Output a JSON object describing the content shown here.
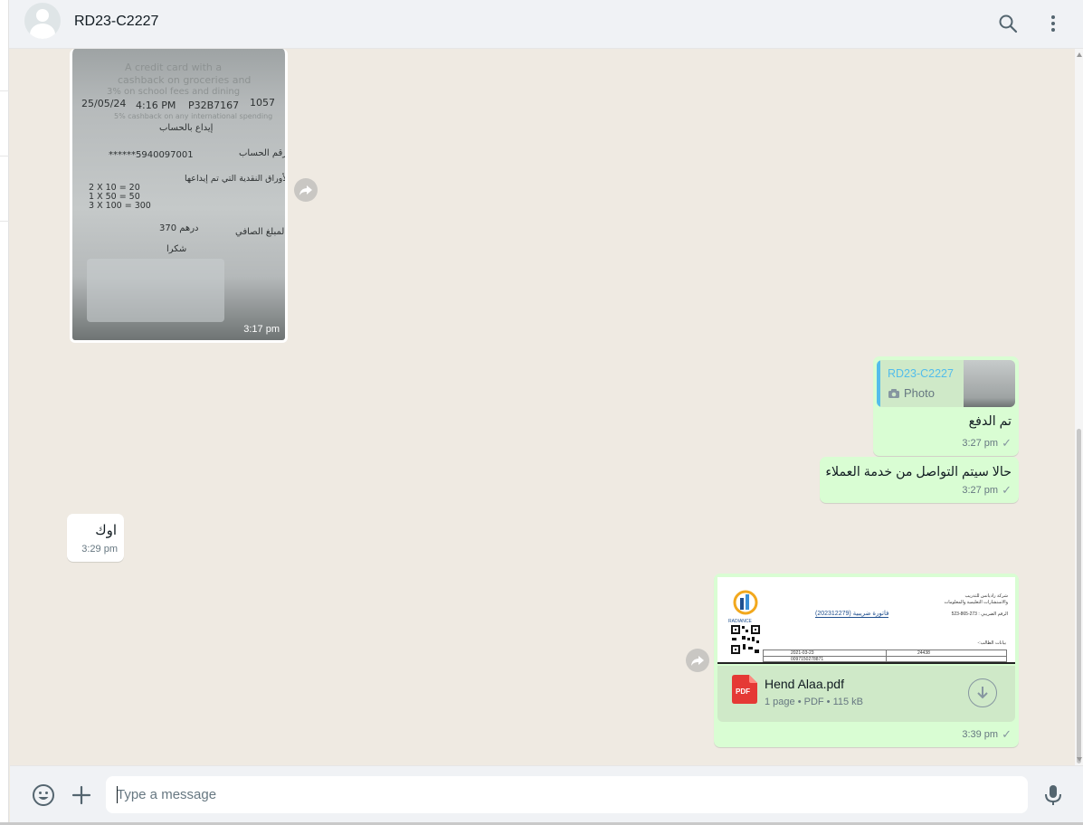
{
  "header": {
    "contact_name": "RD23-C2227",
    "icons": [
      "search-icon",
      "menu-icon"
    ]
  },
  "receipt_photo": {
    "time": "3:17 pm",
    "lines": {
      "promo1": "A credit card with a",
      "promo2": "cashback on groceries and",
      "promo3": "3% on school fees and dining",
      "promo4": "5% cashback on any international spending",
      "date": "25/05/24",
      "clock": "4:16 PM",
      "terminal": "P32B7167",
      "code": "1057",
      "deposit": "إيداع بالحساب",
      "account_label": "رقم الحساب",
      "account_no": "******5940097001",
      "notes_label": "الأوراق النقدية التي تم إيداعها",
      "row1": "2    X   10    =     20",
      "row2": "1    X   50    =     50",
      "row3": "3   X 100    =    300",
      "net_label": "المبلغ الصافي",
      "net_amount": "370  درهم",
      "thanks": "شكرا"
    }
  },
  "messages": {
    "m1": {
      "quote_name": "RD23-C2227",
      "quote_type": "Photo",
      "text": "تم الدفع",
      "time": "3:27 pm"
    },
    "m2": {
      "text": "حالا سيتم التواصل من خدمة العملاء",
      "time": "3:27 pm"
    },
    "m3": {
      "text": "اوك",
      "time": "3:29 pm"
    },
    "m4": {
      "file_name": "Hend Alaa.pdf",
      "file_meta": "1 page • PDF • 115 kB",
      "pdf_badge": "PDF",
      "time": "3:39 pm",
      "preview_logo_text": "RADIANCE",
      "preview_header1": "شركة راديانس للتدريب",
      "preview_header2": "والاستشارات التعليمية والمعلومات",
      "preview_phone": "الرقم الضريبي : 273-865-523",
      "preview_invoice": "فاتورة ضريبية (202312279)",
      "preview_student": "بيانات الطالب:-",
      "preview_date": "2021-03-23",
      "preview_id": "24438",
      "preview_mobile": "0097150278871"
    }
  },
  "footer": {
    "placeholder": "Type a message",
    "icons": [
      "emoji-icon",
      "plus-icon",
      "microphone-icon"
    ]
  }
}
